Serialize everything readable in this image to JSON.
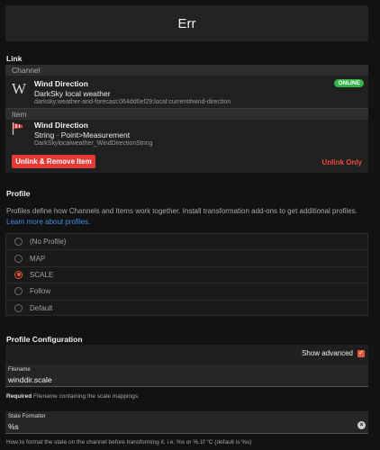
{
  "page": {
    "title": "Err"
  },
  "link": {
    "heading": "Link",
    "channel": {
      "section_label": "Channel",
      "icon_letter": "W",
      "title": "Wind Direction",
      "subtitle": "DarkSky local weather",
      "uid": "darksky:weather-and-forecast:064dd0ef29:local:current#wind-direction",
      "status": "ONLINE"
    },
    "item": {
      "section_label": "Item",
      "icon": "windsock-icon",
      "title": "Wind Direction",
      "subtitle": "String · Point>Measurement",
      "name": "DarkSkylocalweather_WindDirectionString"
    },
    "unlink_remove_label": "Unlink & Remove Item",
    "unlink_only_label": "Unlink Only"
  },
  "profile": {
    "heading": "Profile",
    "description": "Profiles define how Channels and Items work together. Install transformation add-ons to get additional profiles.",
    "learn_more": "Learn more about profiles.",
    "options": [
      "(No Profile)",
      "MAP",
      "SCALE",
      "Follow",
      "Default"
    ],
    "selected": "SCALE"
  },
  "config": {
    "heading": "Profile Configuration",
    "show_advanced_label": "Show advanced",
    "show_advanced_checked": true,
    "filename": {
      "label": "Filename",
      "value": "winddir.scale",
      "required_label": "Required",
      "help": "Filename containing the scale mappings."
    },
    "state_formatter": {
      "label": "State Formatter",
      "value": "%s",
      "help": "How to format the state on the channel before transforming it, i.e. %s or %.1f °C (default is %s)"
    }
  },
  "colors": {
    "accent": "#e5573b",
    "danger": "#e53935",
    "online": "#37b449",
    "link": "#3c8fe8"
  }
}
